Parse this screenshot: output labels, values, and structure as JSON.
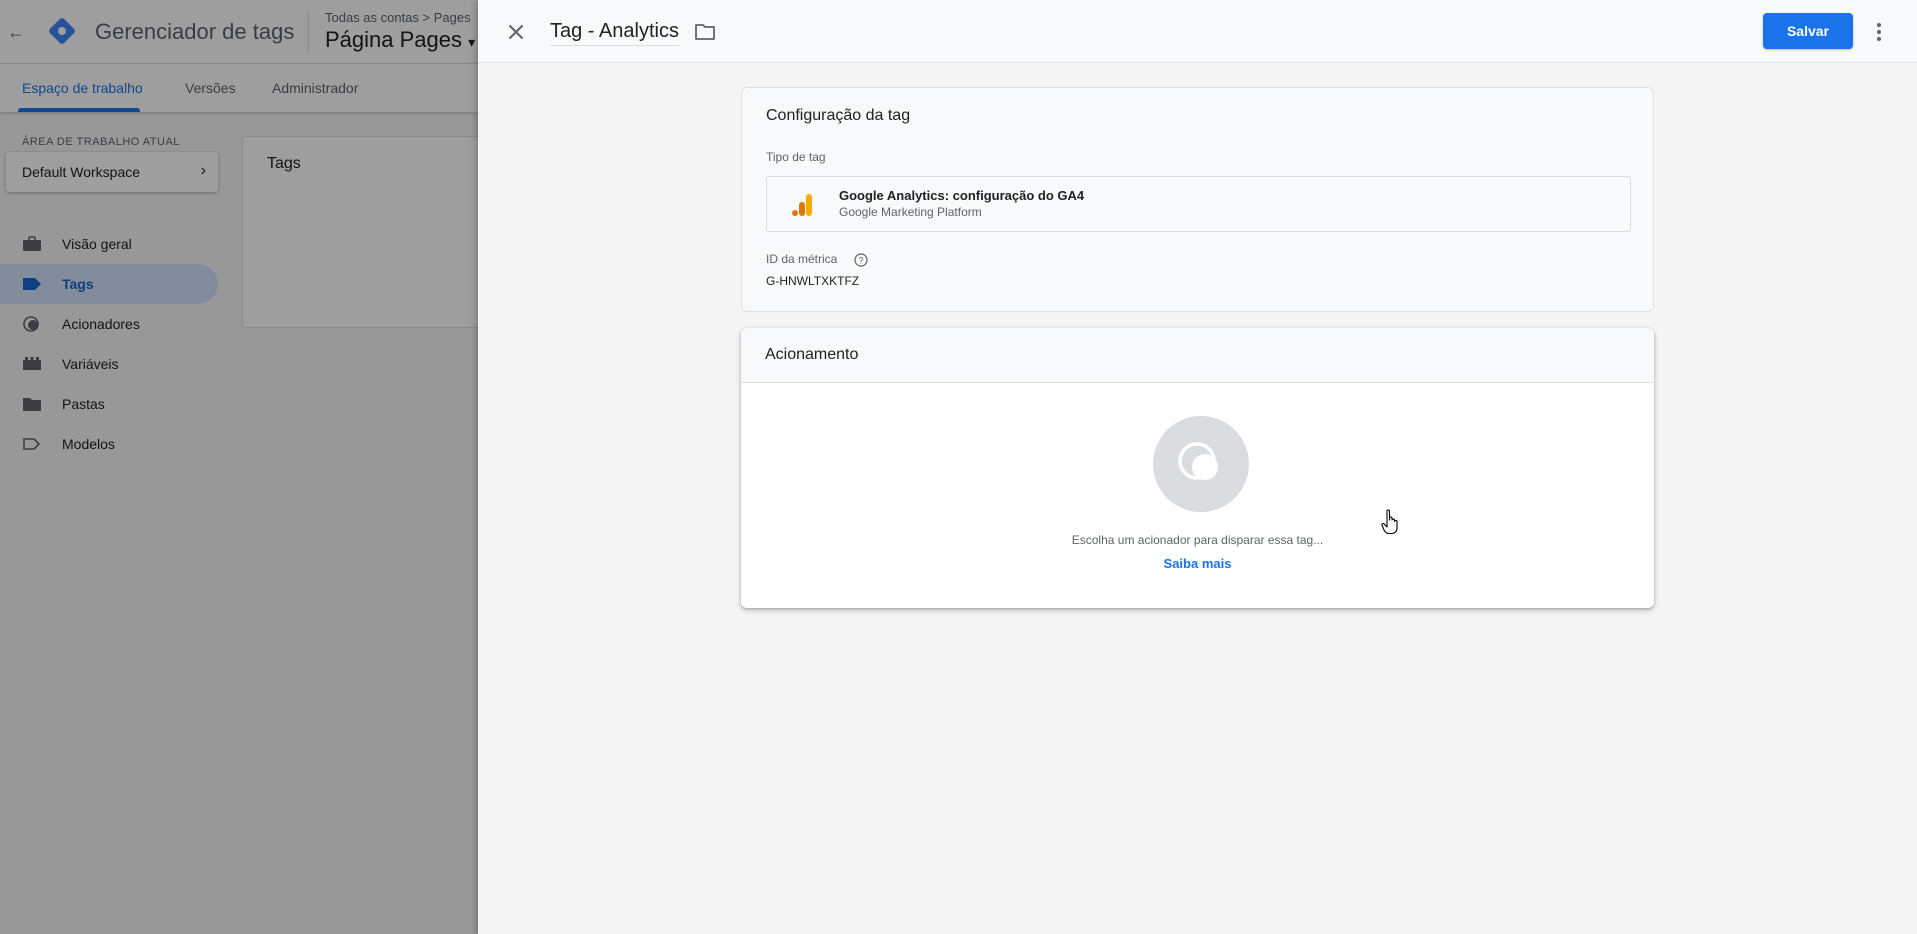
{
  "background": {
    "app_name": "Gerenciador de tags",
    "breadcrumb": "Todas as contas > Pages",
    "container_name": "Página Pages",
    "tabs": [
      "Espaço de trabalho",
      "Versões",
      "Administrador"
    ],
    "workspace_label": "ÁREA DE TRABALHO ATUAL",
    "workspace_name": "Default Workspace",
    "nav": [
      {
        "label": "Visão geral",
        "icon": "briefcase-icon"
      },
      {
        "label": "Tags",
        "icon": "tag-icon"
      },
      {
        "label": "Acionadores",
        "icon": "trigger-icon"
      },
      {
        "label": "Variáveis",
        "icon": "variables-icon"
      },
      {
        "label": "Pastas",
        "icon": "folder-icon"
      },
      {
        "label": "Modelos",
        "icon": "template-icon"
      }
    ],
    "active_nav": "Tags",
    "card_title": "Tags"
  },
  "panel": {
    "title": "Tag - Analytics",
    "save_label": "Salvar",
    "config": {
      "title": "Configuração da tag",
      "tag_type_label": "Tipo de tag",
      "tag_type_name": "Google Analytics: configuração do GA4",
      "tag_type_provider": "Google Marketing Platform",
      "metric_id_label": "ID da métrica",
      "metric_id_value": "G-HNWLTXKTFZ"
    },
    "trigger": {
      "title": "Acionamento",
      "message": "Escolha um acionador para disparar essa tag...",
      "learn_more": "Saiba mais"
    }
  },
  "colors": {
    "accent": "#1a73e8",
    "ga_orange": "#f9ab00",
    "ga_dark_orange": "#e37400"
  }
}
